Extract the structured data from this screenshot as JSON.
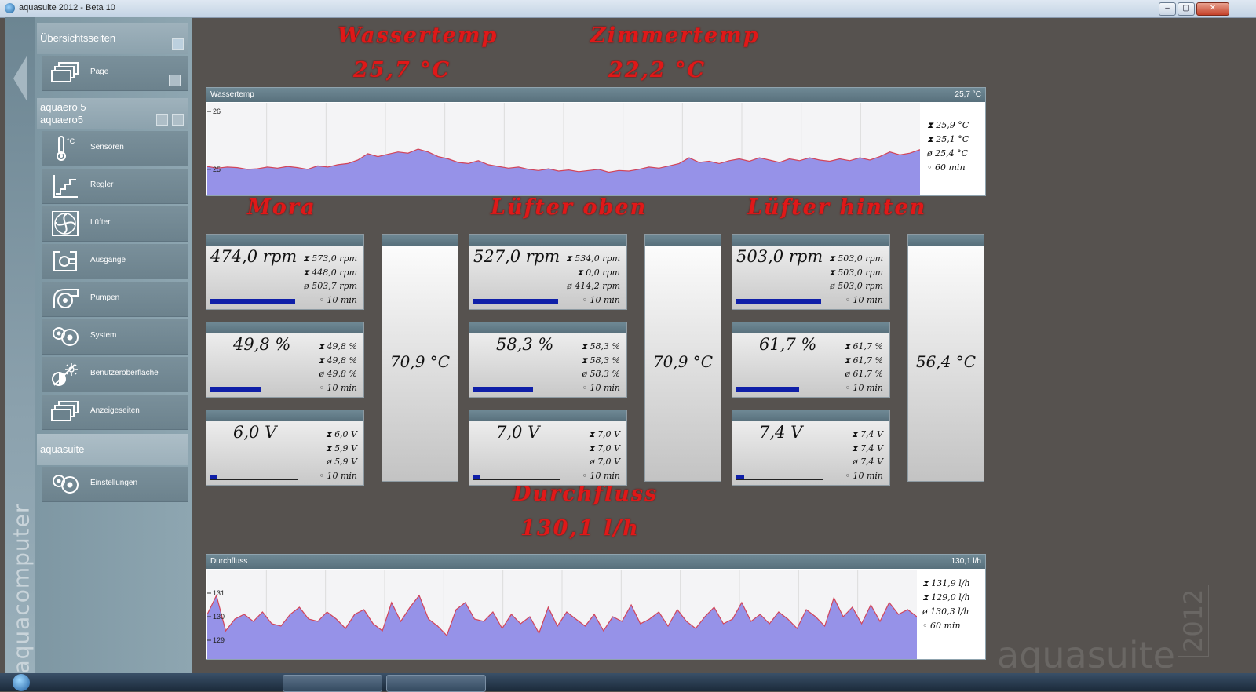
{
  "window": {
    "title": "aquasuite 2012 - Beta 10",
    "minimize": "–",
    "maximize": "▢",
    "close": "✕"
  },
  "brand": {
    "vertical": "aquacomputer",
    "watermark": "aquasuite",
    "year": "2012"
  },
  "sidebar": {
    "overview": {
      "header": "Übersichtsseiten",
      "items": [
        {
          "label": "Page",
          "icon": "pages-icon"
        }
      ]
    },
    "device": {
      "header_line1": "aquaero 5",
      "header_line2": "aquaero5",
      "items": [
        {
          "label": "Sensoren",
          "icon": "thermometer-icon"
        },
        {
          "label": "Regler",
          "icon": "controller-curve-icon"
        },
        {
          "label": "Lüfter",
          "icon": "fan-icon"
        },
        {
          "label": "Ausgänge",
          "icon": "plug-icon"
        },
        {
          "label": "Pumpen",
          "icon": "pump-icon"
        },
        {
          "label": "System",
          "icon": "system-gears-icon"
        },
        {
          "label": "Benutzeroberfläche",
          "icon": "brightness-icon"
        },
        {
          "label": "Anzeigeseiten",
          "icon": "display-pages-icon"
        }
      ]
    },
    "suite": {
      "header": "aquasuite",
      "items": [
        {
          "label": "Einstellungen",
          "icon": "settings-gears-icon"
        }
      ]
    }
  },
  "labels": {
    "wassertemp_title": "Wassertemp",
    "wassertemp_value": "25,7 °C",
    "zimmertemp_title": "Zimmertemp",
    "zimmertemp_value": "22,2 °C",
    "mora": "Mora",
    "luefter_oben": "Lüfter oben",
    "luefter_hinten": "Lüfter hinten",
    "durchfluss_title": "Durchfluss",
    "durchfluss_value": "130,1 l/h"
  },
  "charts": {
    "water": {
      "title": "Wassertemp",
      "current": "25,7 °C",
      "y_ticks": [
        "26",
        "25"
      ],
      "stats": [
        "25,9 °C",
        "25,1 °C",
        "25,4 °C",
        "60 min"
      ],
      "fill_color": "#9692e8",
      "line_color": "#d2455a"
    },
    "flow": {
      "title": "Durchfluss",
      "current": "130,1 l/h",
      "y_ticks": [
        "131",
        "130",
        "129"
      ],
      "stats": [
        "131,9 l/h",
        "129,0 l/h",
        "130,3 l/h",
        "60 min"
      ],
      "fill_color": "#9692e8",
      "line_color": "#d2455a"
    }
  },
  "chart_data": [
    {
      "type": "area",
      "title": "Wassertemp",
      "xlabel": "",
      "ylabel": "",
      "ylim": [
        24.55,
        26.15
      ],
      "x_label": "60 min",
      "y_ticks": [
        26,
        25
      ],
      "series": [
        {
          "values": [
            25.05,
            25.02,
            25.04,
            25.03,
            25.0,
            25.01,
            25.04,
            25.02,
            25.05,
            25.03,
            25.0,
            25.06,
            25.04,
            25.08,
            25.1,
            25.16,
            25.27,
            25.22,
            25.26,
            25.3,
            25.28,
            25.35,
            25.3,
            25.22,
            25.18,
            25.12,
            25.1,
            25.15,
            25.08,
            25.05,
            25.02,
            25.04,
            25.0,
            24.98,
            25.01,
            24.97,
            24.99,
            24.96,
            24.98,
            25.0,
            24.95,
            24.98,
            24.97,
            25.0,
            25.04,
            25.02,
            25.06,
            25.1,
            25.2,
            25.12,
            25.14,
            25.1,
            25.15,
            25.18,
            25.14,
            25.2,
            25.16,
            25.12,
            25.18,
            25.15,
            25.2,
            25.16,
            25.14,
            25.18,
            25.15,
            25.2,
            25.16,
            25.22,
            25.3,
            25.25,
            25.28,
            25.34
          ]
        }
      ]
    },
    {
      "type": "area",
      "title": "Durchfluss",
      "xlabel": "",
      "ylabel": "",
      "ylim": [
        128.2,
        132.0
      ],
      "x_label": "60 min",
      "y_ticks": [
        131,
        130,
        129
      ],
      "series": [
        {
          "values": [
            130.1,
            130.9,
            129.4,
            129.9,
            130.1,
            129.8,
            130.2,
            129.7,
            129.6,
            130.1,
            130.4,
            129.9,
            129.8,
            130.2,
            129.9,
            129.5,
            130.1,
            130.3,
            129.7,
            129.4,
            130.6,
            129.8,
            130.4,
            130.9,
            129.9,
            129.6,
            129.2,
            130.3,
            130.6,
            129.9,
            129.8,
            130.2,
            129.5,
            130.1,
            129.7,
            130.0,
            129.3,
            130.4,
            129.6,
            130.2,
            129.9,
            129.6,
            130.1,
            129.4,
            130.0,
            129.8,
            130.5,
            129.7,
            129.9,
            130.2,
            129.6,
            130.3,
            129.8,
            129.5,
            130.0,
            130.4,
            129.7,
            129.9,
            130.6,
            129.8,
            130.1,
            129.7,
            130.2,
            129.9,
            129.5,
            130.3,
            130.0,
            129.6,
            130.8,
            130.0,
            130.4,
            129.7,
            130.5,
            129.8,
            130.6,
            130.1,
            130.3,
            130.0
          ]
        }
      ]
    }
  ],
  "gauges": {
    "mora": {
      "rpm": {
        "value": "474,0 rpm",
        "stats": [
          "573,0 rpm",
          "448,0 rpm",
          "503,7 rpm",
          "10 min"
        ],
        "level": 0.98
      },
      "pct": {
        "value": "49,8 %",
        "stats": [
          "49,8 %",
          "49,8 %",
          "49,8 %",
          "10 min"
        ],
        "level": 0.59
      },
      "volt": {
        "value": "6,0 V",
        "stats": [
          "6,0 V",
          "5,9 V",
          "5,9 V",
          "10 min"
        ],
        "level": 0.07
      },
      "temp": "70,9 °C"
    },
    "oben": {
      "rpm": {
        "value": "527,0 rpm",
        "stats": [
          "534,0 rpm",
          "0,0 rpm",
          "414,2 rpm",
          "10 min"
        ],
        "level": 0.98
      },
      "pct": {
        "value": "58,3 %",
        "stats": [
          "58,3 %",
          "58,3 %",
          "58,3 %",
          "10 min"
        ],
        "level": 0.69
      },
      "volt": {
        "value": "7,0 V",
        "stats": [
          "7,0 V",
          "7,0 V",
          "7,0 V",
          "10 min"
        ],
        "level": 0.08
      },
      "temp": "70,9 °C"
    },
    "hinten": {
      "rpm": {
        "value": "503,0 rpm",
        "stats": [
          "503,0 rpm",
          "503,0 rpm",
          "503,0 rpm",
          "10 min"
        ],
        "level": 0.98
      },
      "pct": {
        "value": "61,7 %",
        "stats": [
          "61,7 %",
          "61,7 %",
          "61,7 %",
          "10 min"
        ],
        "level": 0.73
      },
      "volt": {
        "value": "7,4 V",
        "stats": [
          "7,4 V",
          "7,4 V",
          "7,4 V",
          "10 min"
        ],
        "level": 0.09
      },
      "temp": "56,4 °C"
    }
  },
  "stat_symbols": [
    "⧗",
    "⧗",
    "ø",
    "◦"
  ]
}
